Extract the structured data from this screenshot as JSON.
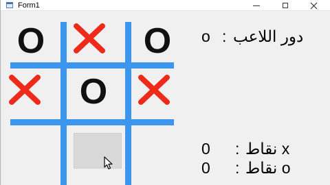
{
  "window": {
    "title": "Form1"
  },
  "board": {
    "cells": [
      "O",
      "X",
      "O",
      "X",
      "O",
      "X",
      "",
      "",
      ""
    ],
    "colors": {
      "grid": "#3d96ee",
      "x_mark": "#ee2a1b",
      "o_mark": "#111111",
      "button": "#d9d9d9"
    }
  },
  "status": {
    "turn_label": "دور اللاعب",
    "turn_separator": ":",
    "turn_value": "o"
  },
  "scores": {
    "x_label": "نقاط x",
    "x_separator": ":",
    "x_value": "0",
    "o_label": "نقاط o",
    "o_separator": ":",
    "o_value": "0"
  }
}
